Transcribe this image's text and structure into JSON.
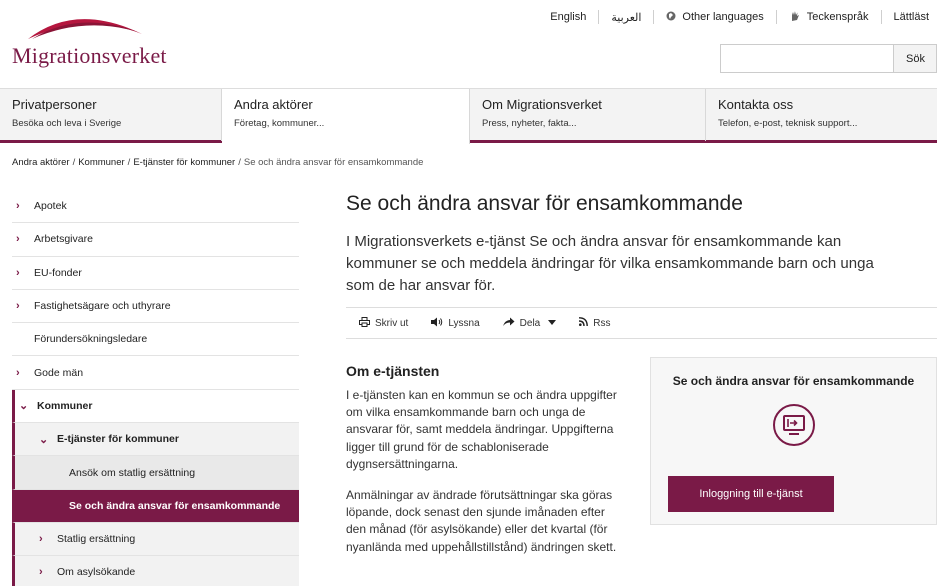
{
  "brand": {
    "name": "Migrationsverket",
    "color": "#7a1a47"
  },
  "toplinks": [
    {
      "label": "English",
      "icon": ""
    },
    {
      "label": "العربية",
      "icon": ""
    },
    {
      "label": "Other languages",
      "icon": "globe-icon"
    },
    {
      "label": "Teckenspråk",
      "icon": "sign-language-hand-icon"
    },
    {
      "label": "Lättläst",
      "icon": ""
    }
  ],
  "search": {
    "value": "",
    "placeholder": "",
    "button_label": "Sök"
  },
  "mainnav": [
    {
      "title": "Privatpersoner",
      "sub": "Besöka och leva i Sverige"
    },
    {
      "title": "Andra aktörer",
      "sub": "Företag, kommuner..."
    },
    {
      "title": "Om Migrationsverket",
      "sub": "Press, nyheter, fakta..."
    },
    {
      "title": "Kontakta oss",
      "sub": "Telefon, e-post, teknisk support..."
    }
  ],
  "breadcrumb": {
    "items": [
      "Andra aktörer",
      "Kommuner",
      "E-tjänster för kommuner"
    ],
    "current": "Se och ändra ansvar för ensamkommande"
  },
  "sidebar": [
    {
      "label": "Apotek"
    },
    {
      "label": "Arbetsgivare"
    },
    {
      "label": "EU-fonder"
    },
    {
      "label": "Fastighetsägare och uthyrare"
    },
    {
      "label": "Förundersökningsledare"
    },
    {
      "label": "Gode män"
    },
    {
      "label": "Kommuner"
    },
    {
      "label": "E-tjänster för kommuner"
    },
    {
      "label": "Ansök om statlig ersättning"
    },
    {
      "label": "Se och ändra ansvar för ensamkommande"
    },
    {
      "label": "Statlig ersättning"
    },
    {
      "label": "Om asylsökande"
    }
  ],
  "page": {
    "title": "Se och ändra ansvar för ensamkommande",
    "lead": "I Migrationsverkets e-tjänst Se och ändra ansvar för ensamkommande kan kommuner se och meddela ändringar för vilka ensamkommande barn och unga som de har ansvar för."
  },
  "tools": {
    "print": "Skriv ut",
    "listen": "Lyssna",
    "share": "Dela",
    "rss": "Rss"
  },
  "article": {
    "heading": "Om e-tjänsten",
    "paragraphs": [
      "I e-tjänsten kan en kommun se och ändra uppgifter om vilka ensamkommande barn och unga de ansvarar för, samt meddela ändringar. Uppgifterna ligger till grund för de schabloniserade dygnsersättningarna.",
      "Anmälningar av ändrade förutsättningar ska göras löpande, dock senast den sjunde imånaden efter den månad (för asylsökande) eller det kvartal (för nyanlända med uppehållstillstånd) ändringen skett."
    ]
  },
  "card": {
    "title": "Se och ändra ansvar för ensamkommande",
    "button_label": "Inloggning till e-tjänst"
  }
}
